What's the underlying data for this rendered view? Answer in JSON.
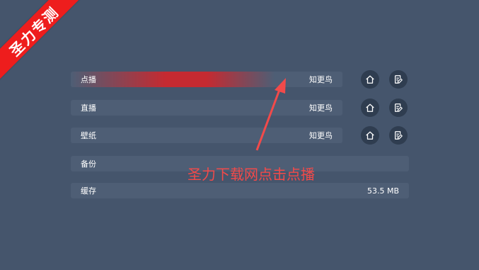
{
  "watermark": {
    "text": "圣力专测"
  },
  "rows": [
    {
      "label": "点播",
      "value": "知更鸟"
    },
    {
      "label": "直播",
      "value": "知更鸟"
    },
    {
      "label": "壁纸",
      "value": "知更鸟"
    },
    {
      "label": "备份",
      "value": ""
    },
    {
      "label": "缓存",
      "value": "53.5 MB"
    }
  ],
  "annotation": {
    "text": "圣力下载网点击点播"
  },
  "icons": {
    "home": "home-icon",
    "edit": "edit-icon"
  },
  "colors": {
    "background": "#45556c",
    "row": "#4e5e75",
    "highlight": "#c52a31",
    "annotation": "#f24a4a",
    "ribbon": "#ee1d1d",
    "icon_bg": "#2f3d50"
  }
}
